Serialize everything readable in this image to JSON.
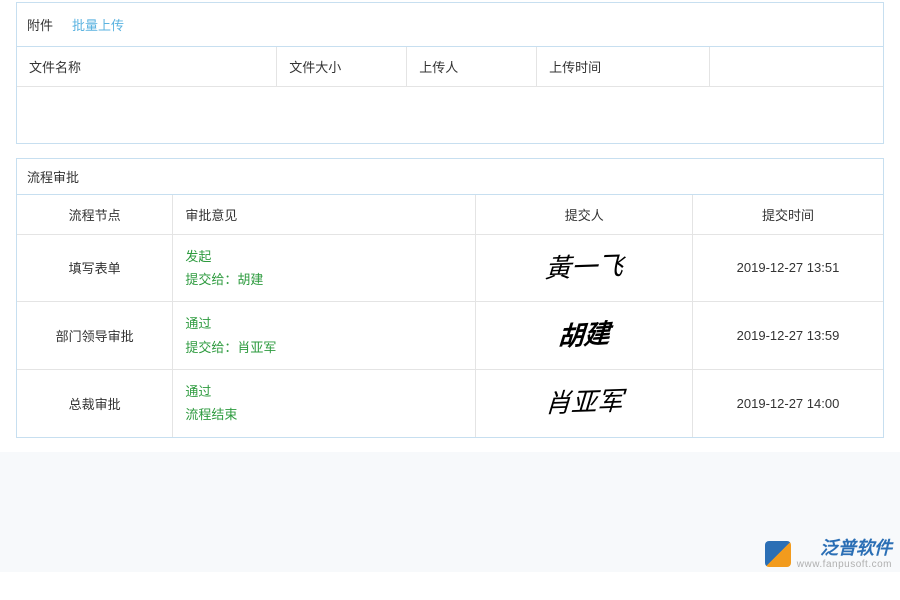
{
  "attachments": {
    "title": "附件",
    "upload_btn": "批量上传",
    "columns": {
      "filename": "文件名称",
      "filesize": "文件大小",
      "uploader": "上传人",
      "upload_time": "上传时间"
    }
  },
  "approval": {
    "title": "流程审批",
    "columns": {
      "node": "流程节点",
      "opinion": "审批意见",
      "submitter": "提交人",
      "submit_time": "提交时间"
    },
    "rows": [
      {
        "node": "填写表单",
        "action": "发起",
        "forward_prefix": "提交给：",
        "forward_to": "胡建",
        "signature": "黃一飞",
        "time": "2019-12-27 13:51"
      },
      {
        "node": "部门领导审批",
        "action": "通过",
        "forward_prefix": "提交给：",
        "forward_to": "肖亚军",
        "signature": "胡建",
        "time": "2019-12-27 13:59"
      },
      {
        "node": "总裁审批",
        "action": "通过",
        "forward_prefix": "",
        "forward_to": "流程结束",
        "signature": "肖亚军",
        "time": "2019-12-27 14:00"
      }
    ]
  },
  "brand": {
    "name": "泛普软件",
    "url": "www.fanpusoft.com"
  }
}
